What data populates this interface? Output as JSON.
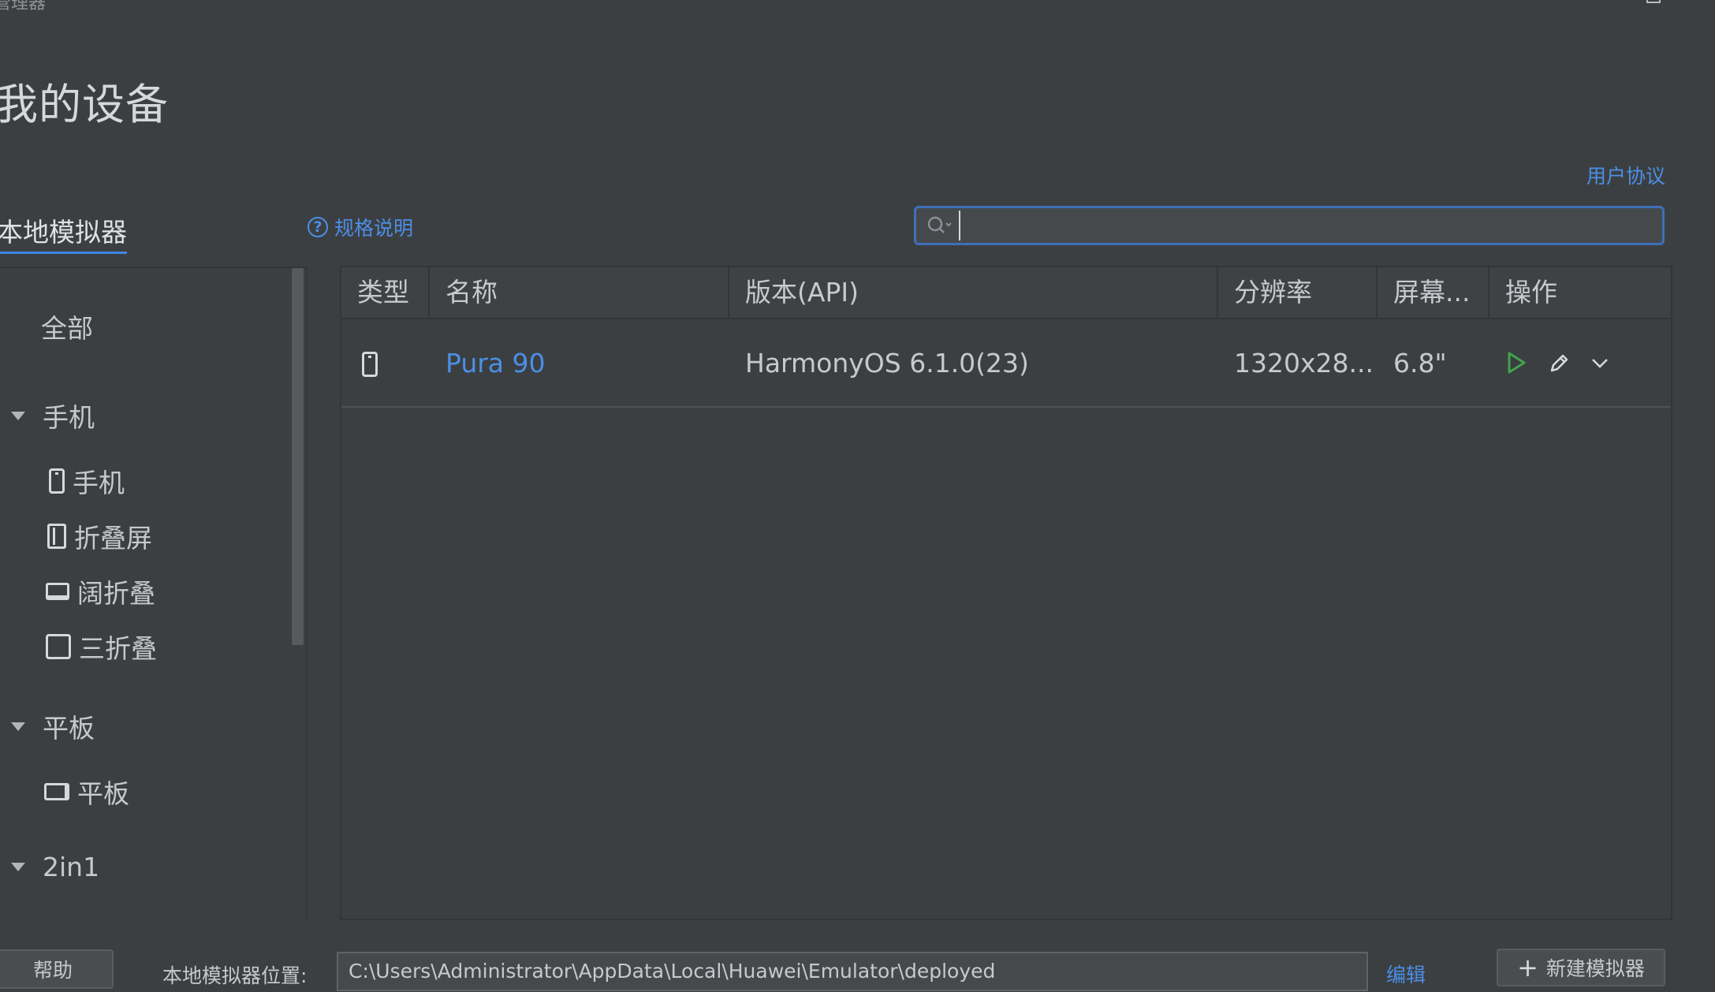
{
  "window": {
    "title": "管理器"
  },
  "header": {
    "title": "我的设备",
    "user_agreement": "用户协议"
  },
  "tabs": {
    "local": "本地模拟器"
  },
  "spec": {
    "label": "规格说明"
  },
  "search": {
    "value": ""
  },
  "sidebar": {
    "all": "全部",
    "groups": [
      {
        "label": "手机",
        "items": [
          {
            "label": "手机",
            "icon": "phone-icon"
          },
          {
            "label": "折叠屏",
            "icon": "foldable-icon"
          },
          {
            "label": "阔折叠",
            "icon": "wide-fold-icon"
          },
          {
            "label": "三折叠",
            "icon": "tri-fold-icon"
          }
        ]
      },
      {
        "label": "平板",
        "items": [
          {
            "label": "平板",
            "icon": "tablet-icon"
          }
        ]
      },
      {
        "label": "2in1",
        "items": []
      }
    ]
  },
  "table": {
    "columns": [
      "类型",
      "名称",
      "版本(API)",
      "分辨率",
      "屏幕...",
      "操作"
    ],
    "rows": [
      {
        "type_icon": "phone-icon",
        "name": "Pura 90",
        "version": "HarmonyOS 6.1.0(23)",
        "resolution": "1320x28...",
        "screen": "6.8\""
      }
    ]
  },
  "footer": {
    "help": "帮助",
    "location_label": "本地模拟器位置:",
    "location_value": "C:\\Users\\Administrator\\AppData\\Local\\Huawei\\Emulator\\deployed",
    "edit": "编辑",
    "new_emulator": "新建模拟器"
  },
  "colors": {
    "accent": "#4b8fe6",
    "background": "#3c3f41",
    "run": "#3fa34d"
  }
}
